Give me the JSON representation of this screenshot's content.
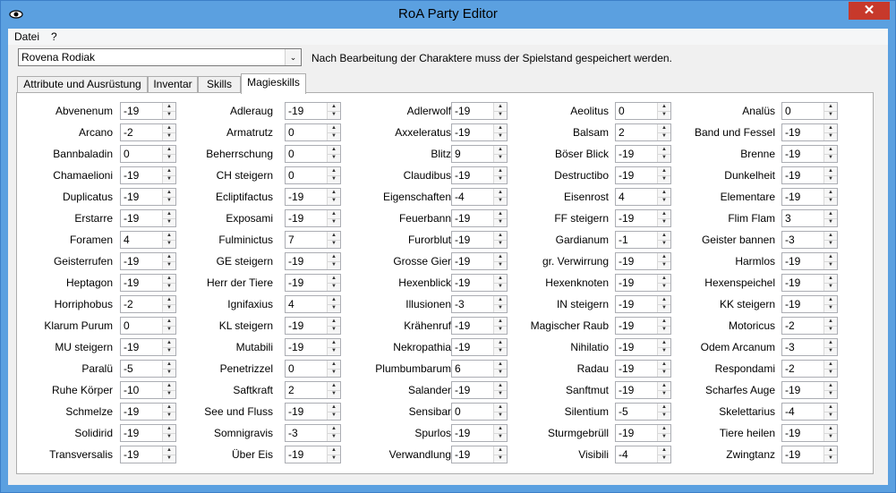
{
  "window": {
    "title": "RoA Party Editor",
    "close_glyph": "✕"
  },
  "menu": [
    "Datei",
    "?"
  ],
  "character_select": {
    "value": "Rovena Rodiak",
    "arrow": "⌄"
  },
  "notice": "Nach Bearbeitung der Charaktere muss der Spielstand gespeichert werden.",
  "tabs": [
    "Attribute und Ausrüstung",
    "Inventar",
    "Skills",
    "Magieskills"
  ],
  "active_tab": "Magieskills",
  "spells": [
    [
      {
        "n": "Abvenenum",
        "v": "-19"
      },
      {
        "n": "Adleraug",
        "v": "-19"
      },
      {
        "n": "Adlerwolf",
        "v": "-19"
      },
      {
        "n": "Aeolitus",
        "v": "0"
      },
      {
        "n": "Analüs",
        "v": "0"
      }
    ],
    [
      {
        "n": "Arcano",
        "v": "-2"
      },
      {
        "n": "Armatrutz",
        "v": "0"
      },
      {
        "n": "Axxeleratus",
        "v": "-19"
      },
      {
        "n": "Balsam",
        "v": "2"
      },
      {
        "n": "Band und Fessel",
        "v": "-19"
      }
    ],
    [
      {
        "n": "Bannbaladin",
        "v": "0"
      },
      {
        "n": "Beherrschung",
        "v": "0"
      },
      {
        "n": "Blitz",
        "v": "9"
      },
      {
        "n": "Böser Blick",
        "v": "-19"
      },
      {
        "n": "Brenne",
        "v": "-19"
      }
    ],
    [
      {
        "n": "Chamaelioni",
        "v": "-19"
      },
      {
        "n": "CH steigern",
        "v": "0"
      },
      {
        "n": "Claudibus",
        "v": "-19"
      },
      {
        "n": "Destructibo",
        "v": "-19"
      },
      {
        "n": "Dunkelheit",
        "v": "-19"
      }
    ],
    [
      {
        "n": "Duplicatus",
        "v": "-19"
      },
      {
        "n": "Ecliptifactus",
        "v": "-19"
      },
      {
        "n": "Eigenschaften",
        "v": "-4"
      },
      {
        "n": "Eisenrost",
        "v": "4"
      },
      {
        "n": "Elementare",
        "v": "-19"
      }
    ],
    [
      {
        "n": "Erstarre",
        "v": "-19"
      },
      {
        "n": "Exposami",
        "v": "-19"
      },
      {
        "n": "Feuerbann",
        "v": "-19"
      },
      {
        "n": "FF steigern",
        "v": "-19"
      },
      {
        "n": "Flim Flam",
        "v": "3"
      }
    ],
    [
      {
        "n": "Foramen",
        "v": "4"
      },
      {
        "n": "Fulminictus",
        "v": "7"
      },
      {
        "n": "Furorblut",
        "v": "-19"
      },
      {
        "n": "Gardianum",
        "v": "-1"
      },
      {
        "n": "Geister bannen",
        "v": "-3"
      }
    ],
    [
      {
        "n": "Geisterrufen",
        "v": "-19"
      },
      {
        "n": "GE steigern",
        "v": "-19"
      },
      {
        "n": "Grosse Gier",
        "v": "-19"
      },
      {
        "n": "gr. Verwirrung",
        "v": "-19"
      },
      {
        "n": "Harmlos",
        "v": "-19"
      }
    ],
    [
      {
        "n": "Heptagon",
        "v": "-19"
      },
      {
        "n": "Herr der Tiere",
        "v": "-19"
      },
      {
        "n": "Hexenblick",
        "v": "-19"
      },
      {
        "n": "Hexenknoten",
        "v": "-19"
      },
      {
        "n": "Hexenspeichel",
        "v": "-19"
      }
    ],
    [
      {
        "n": "Horriphobus",
        "v": "-2"
      },
      {
        "n": "Ignifaxius",
        "v": "4"
      },
      {
        "n": "Illusionen",
        "v": "-3"
      },
      {
        "n": "IN steigern",
        "v": "-19"
      },
      {
        "n": "KK steigern",
        "v": "-19"
      }
    ],
    [
      {
        "n": "Klarum Purum",
        "v": "0"
      },
      {
        "n": "KL steigern",
        "v": "-19"
      },
      {
        "n": "Krähenruf",
        "v": "-19"
      },
      {
        "n": "Magischer Raub",
        "v": "-19"
      },
      {
        "n": "Motoricus",
        "v": "-2"
      }
    ],
    [
      {
        "n": "MU steigern",
        "v": "-19"
      },
      {
        "n": "Mutabili",
        "v": "-19"
      },
      {
        "n": "Nekropathia",
        "v": "-19"
      },
      {
        "n": "Nihilatio",
        "v": "-19"
      },
      {
        "n": "Odem Arcanum",
        "v": "-3"
      }
    ],
    [
      {
        "n": "Paralü",
        "v": "-5"
      },
      {
        "n": "Penetrizzel",
        "v": "0"
      },
      {
        "n": "Plumbumbarum",
        "v": "6"
      },
      {
        "n": "Radau",
        "v": "-19"
      },
      {
        "n": "Respondami",
        "v": "-2"
      }
    ],
    [
      {
        "n": "Ruhe Körper",
        "v": "-10"
      },
      {
        "n": "Saftkraft",
        "v": "2"
      },
      {
        "n": "Salander",
        "v": "-19"
      },
      {
        "n": "Sanftmut",
        "v": "-19"
      },
      {
        "n": "Scharfes Auge",
        "v": "-19"
      }
    ],
    [
      {
        "n": "Schmelze",
        "v": "-19"
      },
      {
        "n": "See und Fluss",
        "v": "-19"
      },
      {
        "n": "Sensibar",
        "v": "0"
      },
      {
        "n": "Silentium",
        "v": "-5"
      },
      {
        "n": "Skelettarius",
        "v": "-4"
      }
    ],
    [
      {
        "n": "Solidirid",
        "v": "-19"
      },
      {
        "n": "Somnigravis",
        "v": "-3"
      },
      {
        "n": "Spurlos",
        "v": "-19"
      },
      {
        "n": "Sturmgebrüll",
        "v": "-19"
      },
      {
        "n": "Tiere heilen",
        "v": "-19"
      }
    ],
    [
      {
        "n": "Transversalis",
        "v": "-19"
      },
      {
        "n": "Über Eis",
        "v": "-19"
      },
      {
        "n": "Verwandlung",
        "v": "-19"
      },
      {
        "n": "Visibili",
        "v": "-4"
      },
      {
        "n": "Zwingtanz",
        "v": "-19"
      }
    ]
  ],
  "spin_up_glyph": "▲",
  "spin_down_glyph": "▼"
}
